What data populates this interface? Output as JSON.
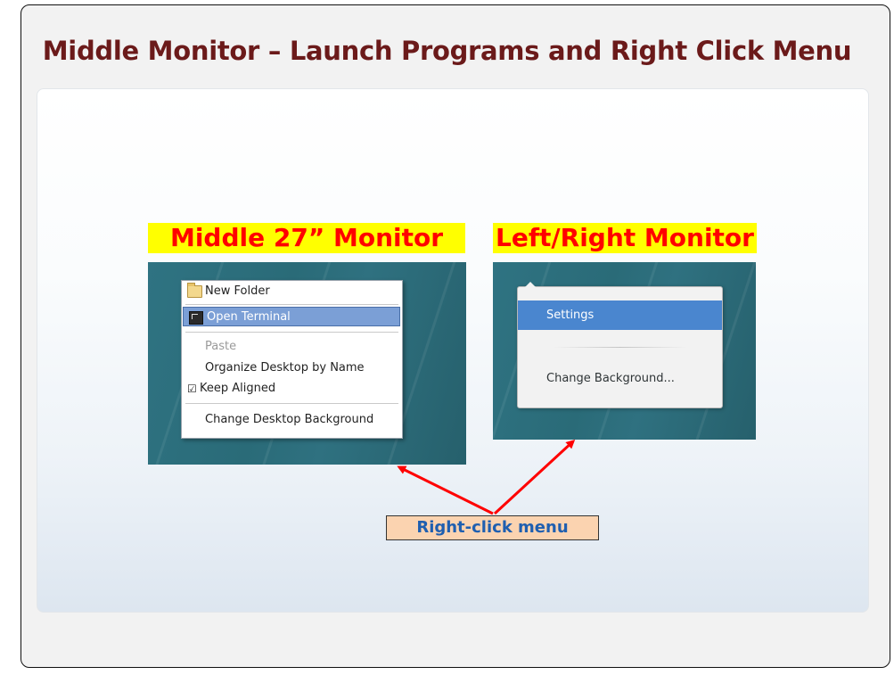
{
  "slide": {
    "title": "Middle Monitor – Launch Programs and Right Click Menu"
  },
  "middle_monitor": {
    "label": "Middle 27” Monitor",
    "menu": {
      "new_folder": "New Folder",
      "open_terminal": "Open Terminal",
      "paste": "Paste",
      "organize": "Organize Desktop by Name",
      "keep_aligned_check": "☑",
      "keep_aligned": "Keep Aligned",
      "change_background": "Change Desktop Background"
    }
  },
  "side_monitor": {
    "label": "Left/Right Monitor",
    "menu": {
      "settings": "Settings",
      "change_background": "Change Background..."
    }
  },
  "callout": {
    "label": "Right-click menu"
  },
  "colors": {
    "title": "#6b1a1a",
    "label_bg": "#ffff00",
    "label_text": "#ff0000",
    "arrow": "#ff0000",
    "callout_bg": "#fbd3b0",
    "callout_text": "#1f5fb0"
  }
}
